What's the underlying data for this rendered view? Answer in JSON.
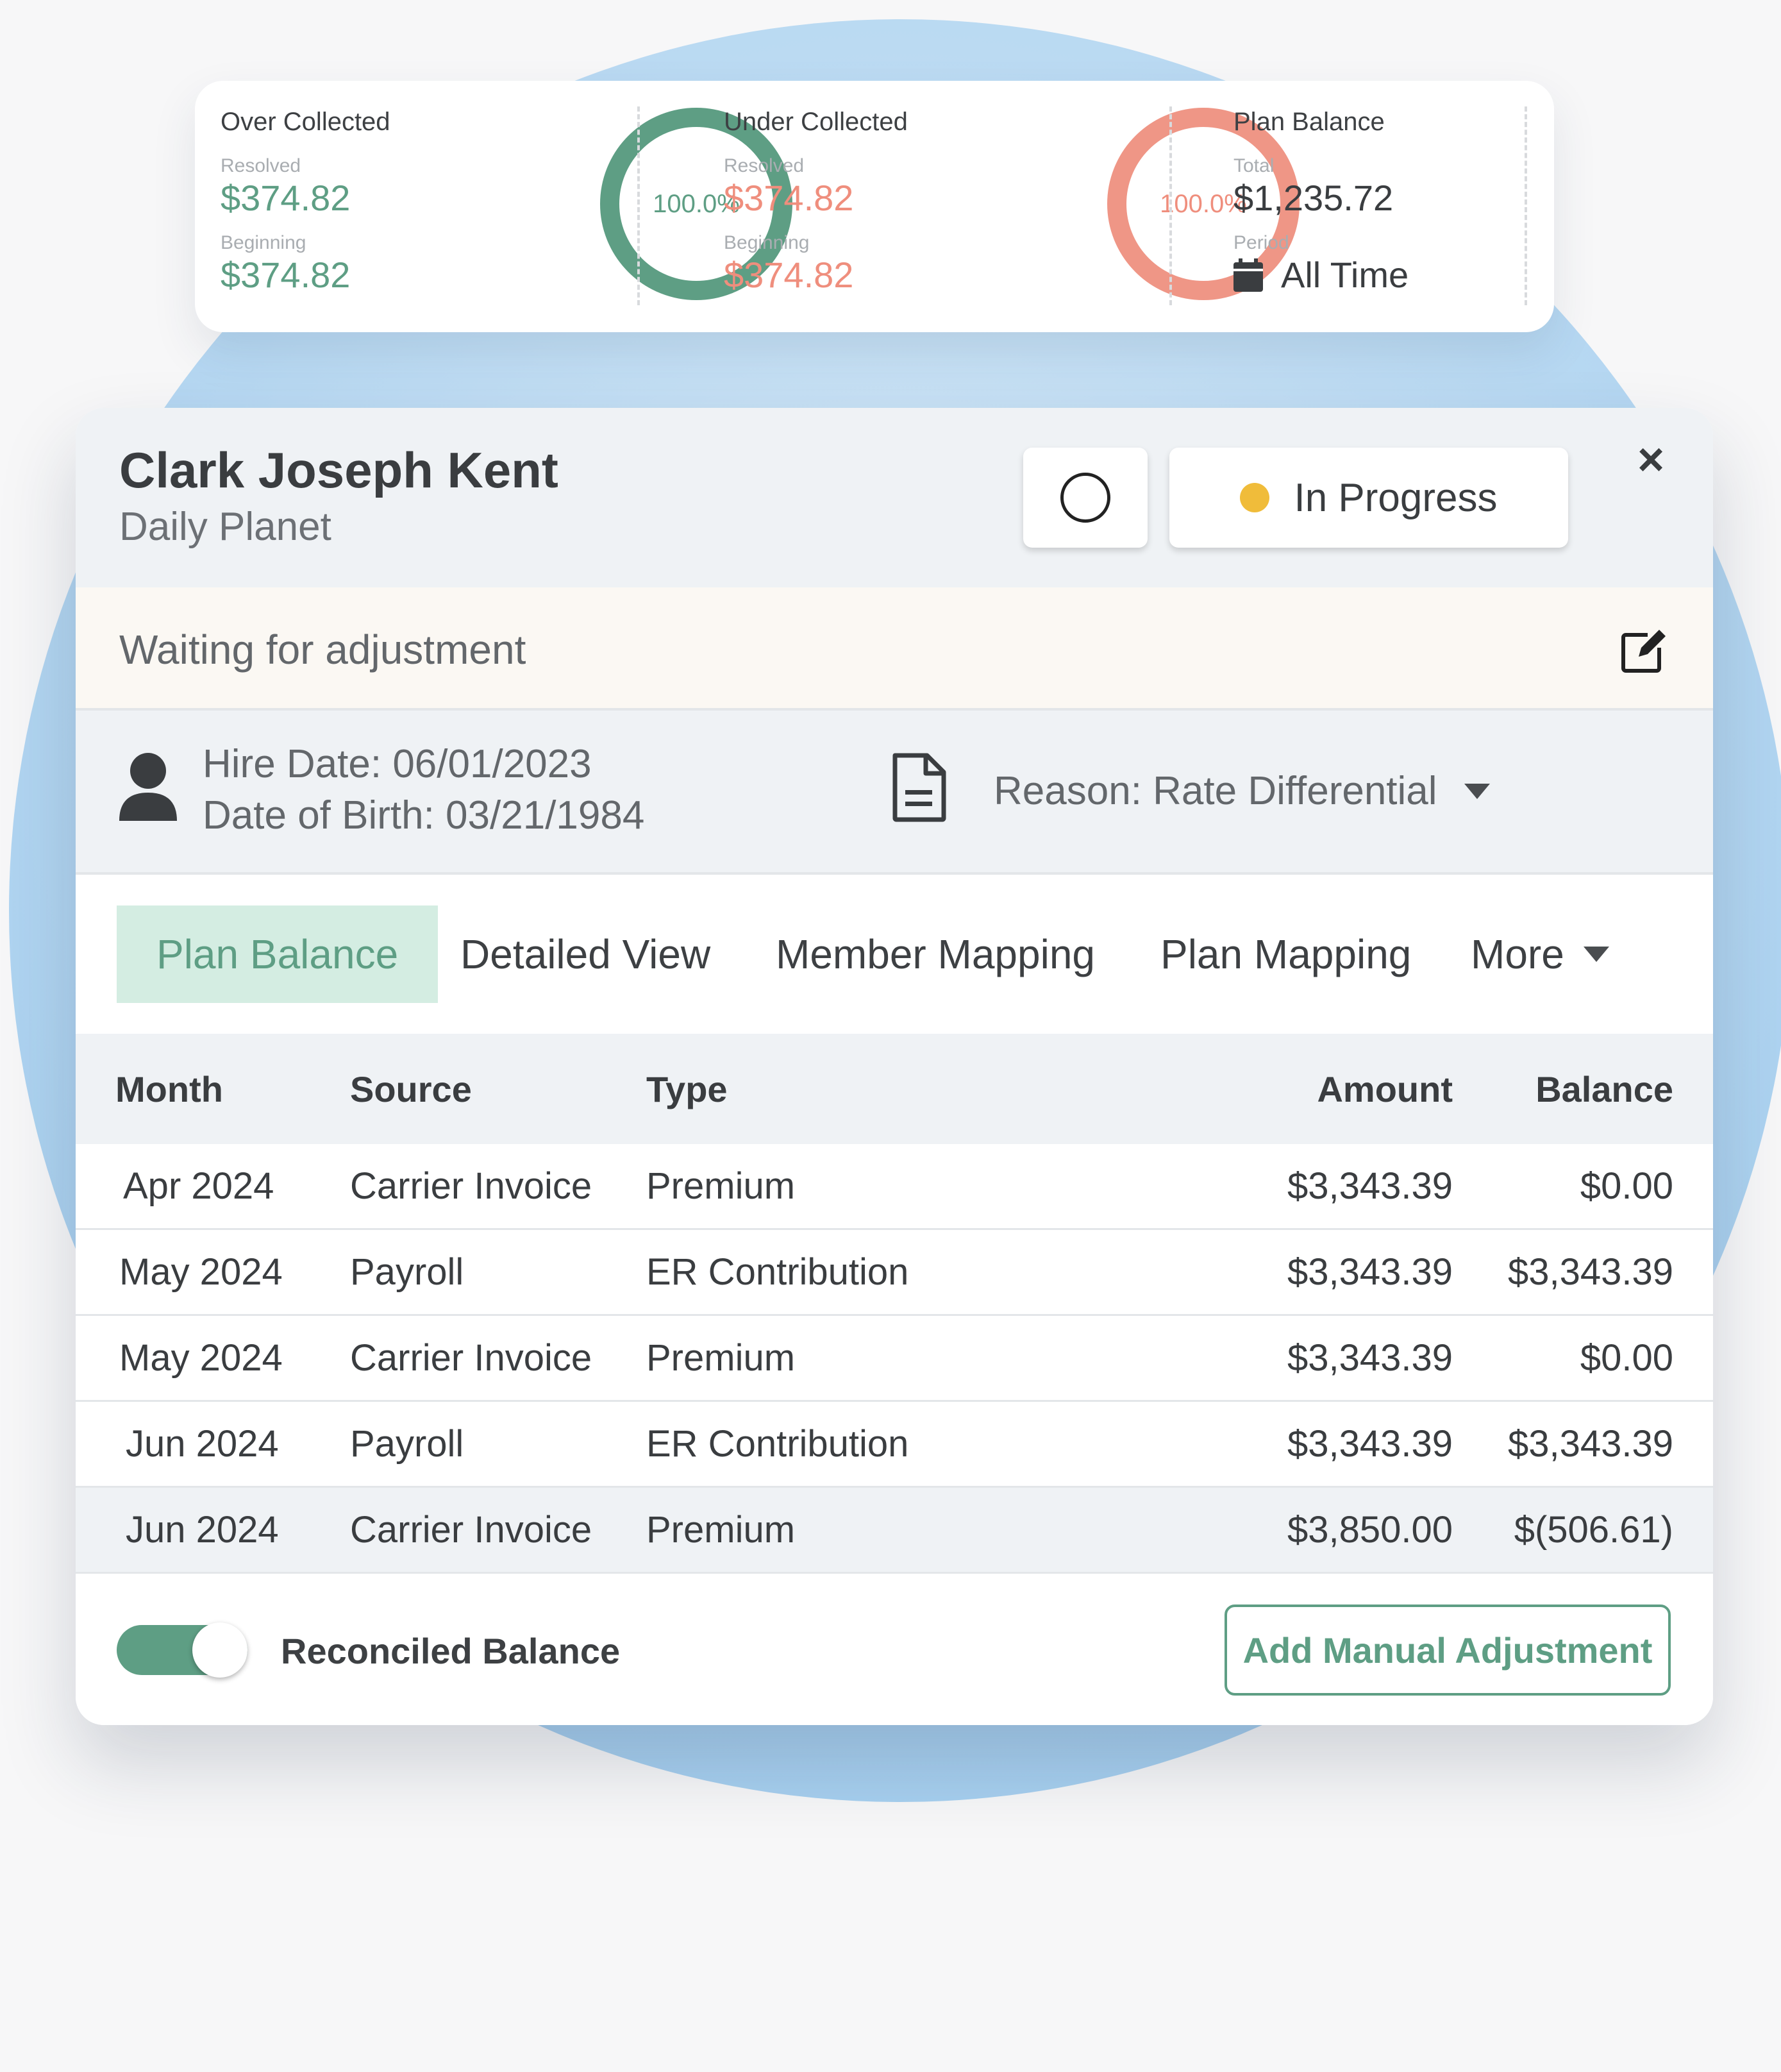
{
  "summary": {
    "over_collected": {
      "title": "Over Collected",
      "resolved_label": "Resolved",
      "resolved_value": "$374.82",
      "beginning_label": "Beginning",
      "beginning_value": "$374.82",
      "percent": "100.0%"
    },
    "under_collected": {
      "title": "Under Collected",
      "resolved_label": "Resolved",
      "resolved_value": "$374.82",
      "beginning_label": "Beginning",
      "beginning_value": "$374.82",
      "percent": "100.0%"
    },
    "plan_balance": {
      "title": "Plan Balance",
      "total_label": "Total",
      "total_value": "$1,235.72",
      "period_label": "Period",
      "period_value": "All Time"
    }
  },
  "header": {
    "name": "Clark Joseph Kent",
    "company": "Daily Planet",
    "status": "In Progress",
    "close_icon": "×"
  },
  "note": "Waiting for adjustment",
  "info": {
    "hire_date": "Hire Date: 06/01/2023",
    "birth_date": "Date of Birth: 03/21/1984",
    "reason": "Reason: Rate Differential"
  },
  "tabs": [
    "Plan Balance",
    "Detailed View",
    "Member Mapping",
    "Plan Mapping",
    "More"
  ],
  "table": {
    "columns": [
      "Month",
      "Source",
      "Type",
      "Amount",
      "Balance"
    ],
    "rows": [
      {
        "month": "Apr 2024",
        "source": "Carrier Invoice",
        "type": "Premium",
        "amount": "$3,343.39",
        "balance": "$0.00"
      },
      {
        "month": "May 2024",
        "source": "Payroll",
        "type": "ER Contribution",
        "amount": "$3,343.39",
        "balance": "$3,343.39"
      },
      {
        "month": "May 2024",
        "source": "Carrier Invoice",
        "type": "Premium",
        "amount": "$3,343.39",
        "balance": "$0.00"
      },
      {
        "month": "Jun 2024",
        "source": "Payroll",
        "type": "ER Contribution",
        "amount": "$3,343.39",
        "balance": "$3,343.39"
      },
      {
        "month": "Jun 2024",
        "source": "Carrier Invoice",
        "type": "Premium",
        "amount": "$3,850.00",
        "balance": "$(506.61)"
      }
    ]
  },
  "footer": {
    "toggle_label": "Reconciled Balance",
    "toggle_on": true,
    "button_label": "Add Manual Adjustment"
  },
  "colors": {
    "accent_green": "#5e9e84",
    "accent_salmon": "#ef8e7d",
    "status_yellow": "#f0bc3a"
  }
}
